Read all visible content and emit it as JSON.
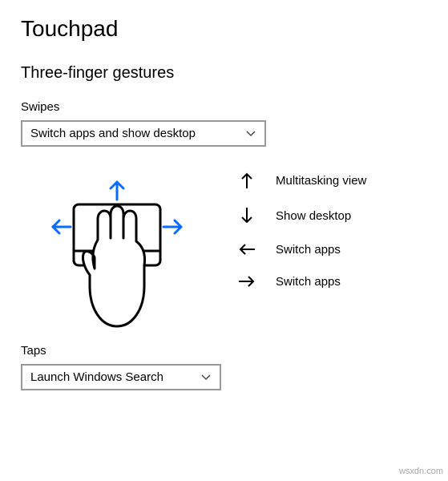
{
  "header": {
    "title": "Touchpad"
  },
  "section": {
    "title": "Three-finger gestures"
  },
  "swipes": {
    "label": "Swipes",
    "selected": "Switch apps and show desktop",
    "legend": {
      "up": "Multitasking view",
      "down": "Show desktop",
      "left": "Switch apps",
      "right": "Switch apps"
    }
  },
  "taps": {
    "label": "Taps",
    "selected": "Launch Windows Search"
  },
  "icons": {
    "chevron": "chevron-down"
  },
  "watermark": "wsxdn.com"
}
